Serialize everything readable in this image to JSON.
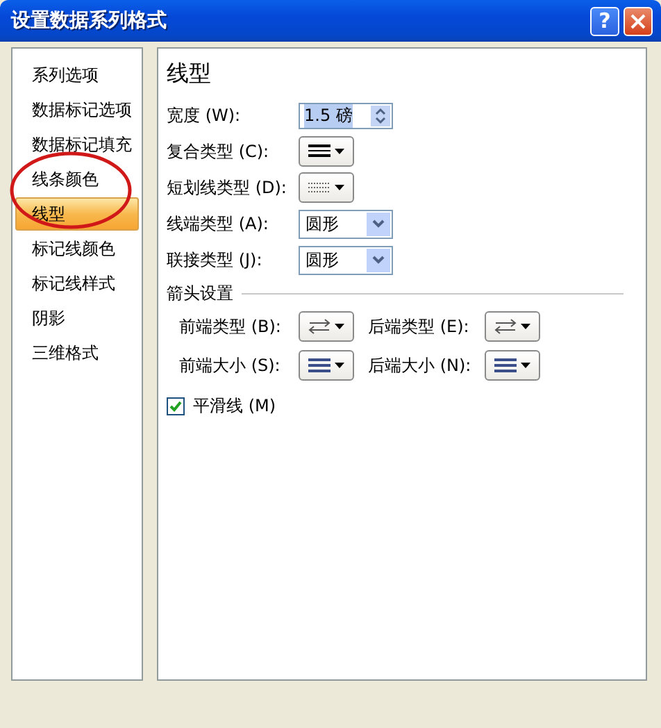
{
  "window": {
    "title": "设置数据系列格式",
    "help_label": "?"
  },
  "sidebar": {
    "items": [
      {
        "label": "系列选项",
        "selected": false
      },
      {
        "label": "数据标记选项",
        "selected": false
      },
      {
        "label": "数据标记填充",
        "selected": false
      },
      {
        "label": "线条颜色",
        "selected": false
      },
      {
        "label": "线型",
        "selected": true
      },
      {
        "label": "标记线颜色",
        "selected": false
      },
      {
        "label": "标记线样式",
        "selected": false
      },
      {
        "label": "阴影",
        "selected": false
      },
      {
        "label": "三维格式",
        "selected": false
      }
    ]
  },
  "annotation": {
    "kind": "ellipse"
  },
  "panel": {
    "title": "线型",
    "fields": [
      {
        "label": "宽度 (W):",
        "kind": "spinner",
        "value": "1.5 磅"
      },
      {
        "label": "复合类型 (C):",
        "kind": "compound"
      },
      {
        "label": "短划线类型 (D):",
        "kind": "dash"
      },
      {
        "label": "线端类型 (A):",
        "kind": "dropdown",
        "value": "圆形"
      },
      {
        "label": "联接类型 (J):",
        "kind": "dropdown",
        "value": "圆形"
      }
    ],
    "arrow_section": {
      "title": "箭头设置",
      "fields": [
        {
          "label": "前端类型 (B):",
          "kind": "arrow"
        },
        {
          "label": "后端类型 (E):",
          "kind": "arrow"
        },
        {
          "label": "前端大小 (S):",
          "kind": "size"
        },
        {
          "label": "后端大小 (N):",
          "kind": "size"
        }
      ]
    },
    "checkbox": {
      "label": "平滑线 (M)",
      "checked": true
    }
  }
}
